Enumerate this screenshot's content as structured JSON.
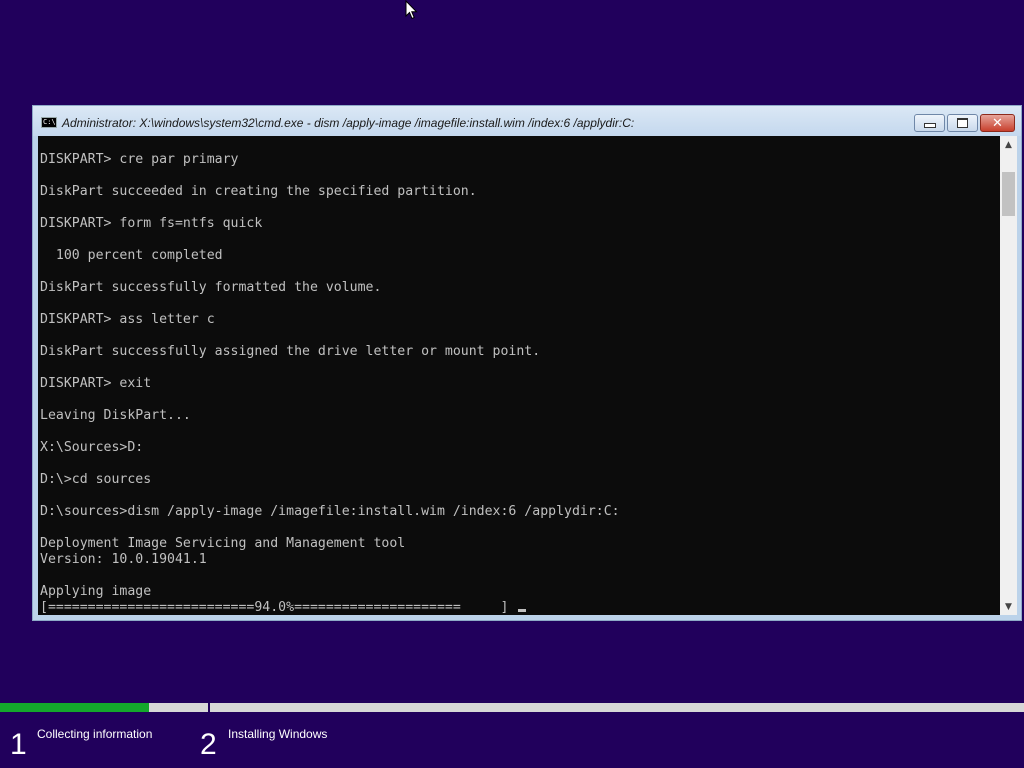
{
  "window": {
    "title": "Administrator: X:\\windows\\system32\\cmd.exe - dism  /apply-image /imagefile:install.wim /index:6 /applydir:C:",
    "icon": "console-app-icon",
    "icon_text": "C:\\",
    "controls": {
      "minimize": "minimize-icon",
      "maximize": "maximize-icon",
      "close": "close-icon",
      "close_glyph": "✕"
    }
  },
  "console": {
    "background": "#0c0c0c",
    "foreground": "#c0c0c0",
    "lines": [
      "DISKPART> cre par primary",
      "",
      "DiskPart succeeded in creating the specified partition.",
      "",
      "DISKPART> form fs=ntfs quick",
      "",
      "  100 percent completed",
      "",
      "DiskPart successfully formatted the volume.",
      "",
      "DISKPART> ass letter c",
      "",
      "DiskPart successfully assigned the drive letter or mount point.",
      "",
      "DISKPART> exit",
      "",
      "Leaving DiskPart...",
      "",
      "X:\\Sources>D:",
      "",
      "D:\\>cd sources",
      "",
      "D:\\sources>dism /apply-image /imagefile:install.wim /index:6 /applydir:C:",
      "",
      "Deployment Image Servicing and Management tool",
      "Version: 10.0.19041.1",
      "",
      "Applying image",
      "[==========================94.0%=====================     ]"
    ]
  },
  "scrollbar": {
    "up_glyph": "▲",
    "down_glyph": "▼"
  },
  "setup": {
    "progress_fraction": 0.1455,
    "progress_color": "#14a82c",
    "steps": [
      {
        "number": "1",
        "label": "Collecting information"
      },
      {
        "number": "2",
        "label": "Installing Windows"
      }
    ]
  }
}
